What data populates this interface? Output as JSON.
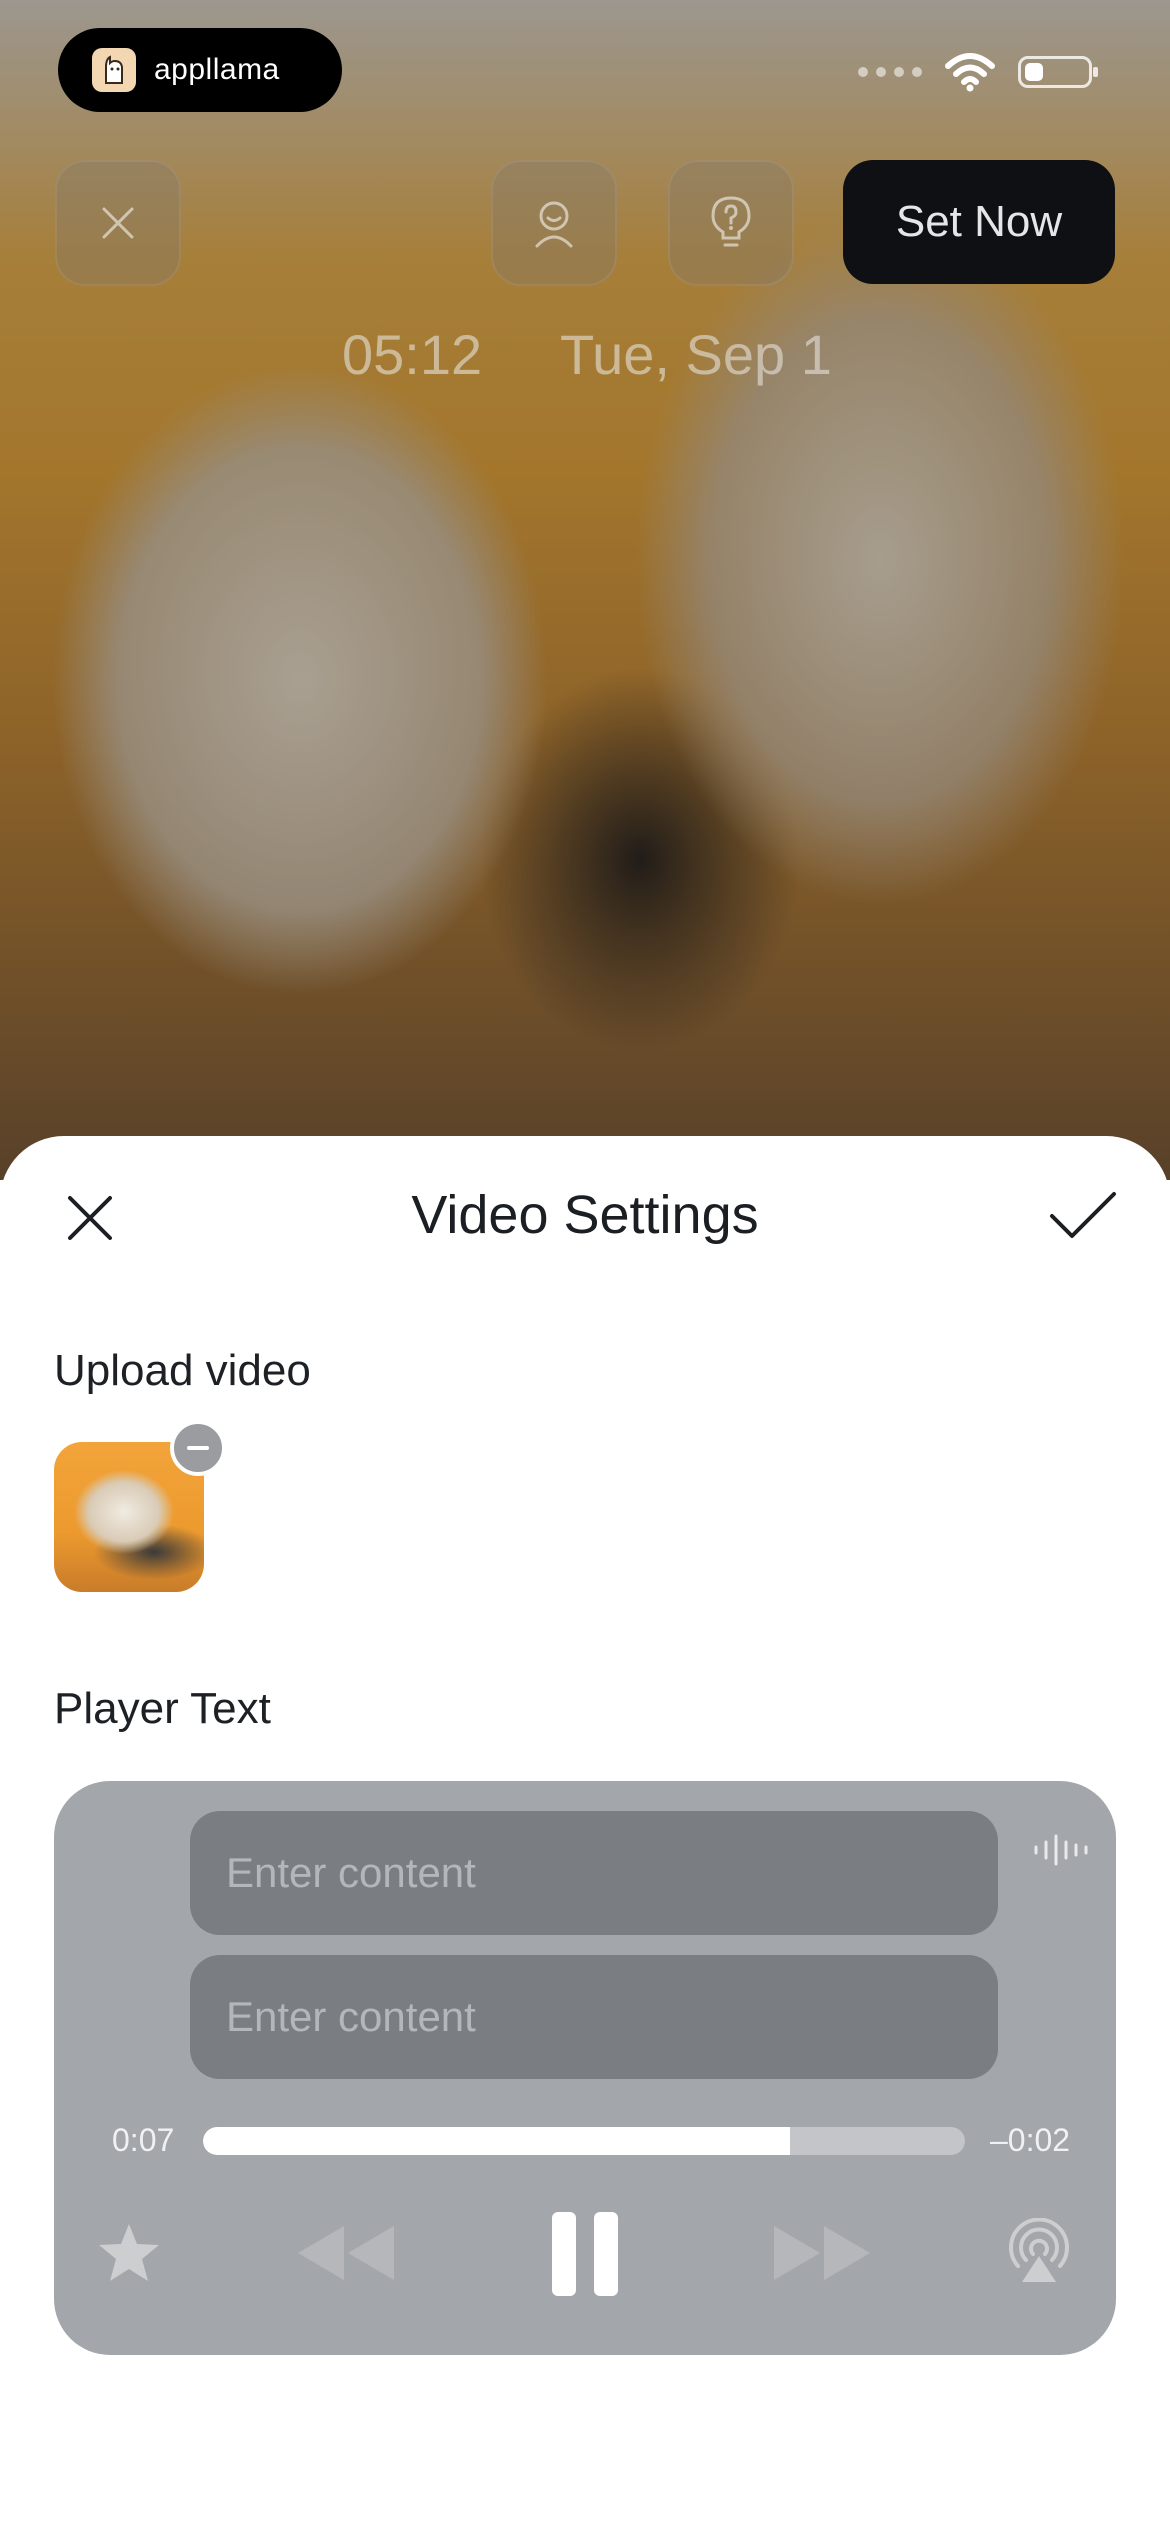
{
  "status_bar": {
    "brand": "appllama"
  },
  "top_toolbar": {
    "set_now_label": "Set Now"
  },
  "lock_screen": {
    "time": "05:12",
    "date": "Tue, Sep 1"
  },
  "sheet": {
    "title": "Video Settings",
    "upload_label": "Upload video",
    "player_text_label": "Player Text"
  },
  "player": {
    "field1_placeholder": "Enter content",
    "field2_placeholder": "Enter content",
    "time_elapsed": "0:07",
    "time_remaining": "–0:02",
    "progress": 0.77
  },
  "icons": [
    "close-icon",
    "avatar-icon",
    "lightbulb-icon",
    "check-icon",
    "waveform-icon",
    "star-icon",
    "rewind-icon",
    "pause-icon",
    "fast-forward-icon",
    "airplay-icon",
    "wifi-icon",
    "battery-icon"
  ],
  "colors": {
    "sheet_bg": "#ffffff",
    "player_bg": "#a3a6aa",
    "field_bg": "#7a7d82",
    "set_now_bg": "#0e1014"
  }
}
